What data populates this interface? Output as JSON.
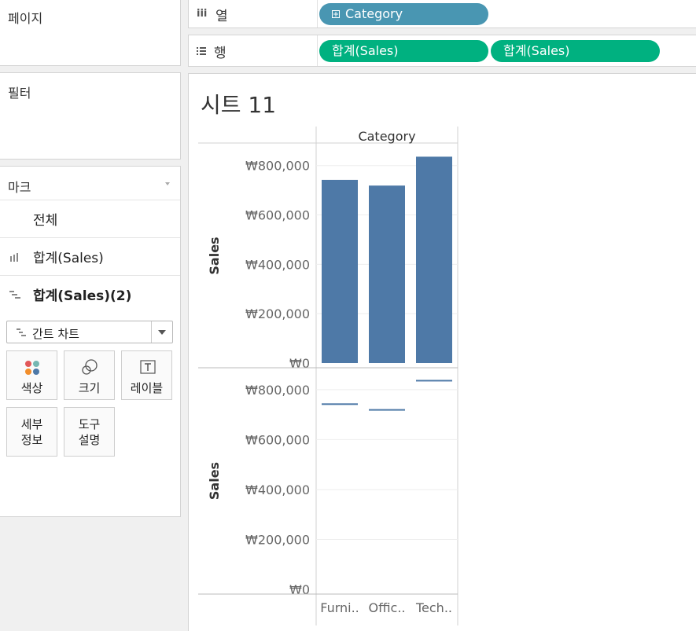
{
  "pages": {
    "title": "페이지"
  },
  "filters": {
    "title": "필터"
  },
  "marks": {
    "title": "마크",
    "cards": [
      "전체",
      "합계(Sales)",
      "합계(Sales)(2)"
    ],
    "mark_type": "간트 차트",
    "buttons": {
      "color": "색상",
      "size": "크기",
      "label": "레이블",
      "detail": [
        "세부",
        "정보"
      ],
      "tooltip": [
        "도구",
        "설명"
      ]
    }
  },
  "columns_shelf": {
    "label": "열",
    "icon": "iii",
    "pills": [
      "Category"
    ]
  },
  "rows_shelf": {
    "label": "행",
    "pills": [
      "합계(Sales)",
      "합계(Sales)"
    ]
  },
  "sheet": {
    "title": "시트 11"
  },
  "colors": {
    "bar": "#4e79a7",
    "dimension_pill": "#4996b2",
    "measure_pill": "#00b180"
  },
  "chart_data": {
    "type": "bar",
    "header": "Category",
    "categories": [
      "Furni..",
      "Offic..",
      "Tech.."
    ],
    "ylabel": "Sales",
    "ylim": [
      0,
      850000
    ],
    "yticks": [
      "₩0",
      "₩200,000",
      "₩400,000",
      "₩600,000",
      "₩800,000"
    ],
    "panes": [
      {
        "mark": "bar",
        "values": [
          742000,
          719000,
          836000
        ]
      },
      {
        "mark": "gantt",
        "values": [
          742000,
          719000,
          836000
        ]
      }
    ]
  }
}
